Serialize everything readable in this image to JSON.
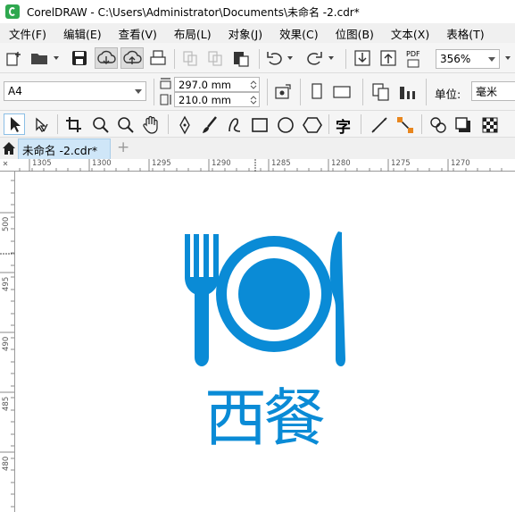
{
  "window": {
    "title": "CorelDRAW - C:\\Users\\Administrator\\Documents\\未命名 -2.cdr*"
  },
  "menu": [
    {
      "label": "文件(F)"
    },
    {
      "label": "编辑(E)"
    },
    {
      "label": "查看(V)"
    },
    {
      "label": "布局(L)"
    },
    {
      "label": "对象(J)"
    },
    {
      "label": "效果(C)"
    },
    {
      "label": "位图(B)"
    },
    {
      "label": "文本(X)"
    },
    {
      "label": "表格(T)"
    }
  ],
  "toolbar": {
    "pdf_label": "PDF",
    "zoom": "356%"
  },
  "property_bar": {
    "page_size": "A4",
    "width": "297.0 mm",
    "height": "210.0 mm",
    "units_label": "单位:",
    "units_value": "毫米"
  },
  "toolbox": {
    "text_tool_glyph": "字"
  },
  "tabs": {
    "active": "未命名 -2.cdr*",
    "add": "+"
  },
  "ruler": {
    "h_ticks": [
      "1305",
      "1300",
      "1295",
      "1290",
      "1285",
      "1280",
      "1275",
      "1270"
    ],
    "v_ticks": [
      "500",
      "495",
      "490",
      "485",
      "480"
    ]
  },
  "artwork": {
    "text": "西餐",
    "color": "#0a8bd6"
  }
}
